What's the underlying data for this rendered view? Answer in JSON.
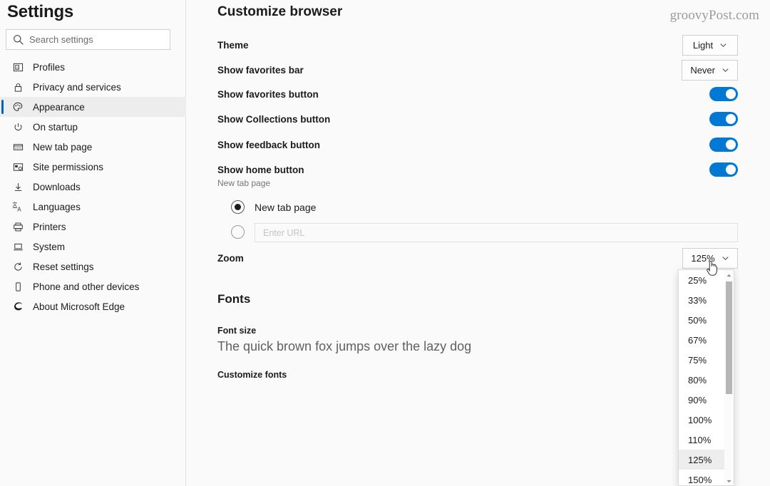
{
  "sidebar": {
    "title": "Settings",
    "search": {
      "placeholder": "Search settings",
      "icon": "search-icon"
    },
    "items": [
      {
        "label": "Profiles",
        "icon": "contact-card-icon",
        "active": false
      },
      {
        "label": "Privacy and services",
        "icon": "lock-icon",
        "active": false
      },
      {
        "label": "Appearance",
        "icon": "palette-icon",
        "active": true
      },
      {
        "label": "On startup",
        "icon": "power-icon",
        "active": false
      },
      {
        "label": "New tab page",
        "icon": "new-tab-icon",
        "active": false
      },
      {
        "label": "Site permissions",
        "icon": "permissions-icon",
        "active": false
      },
      {
        "label": "Downloads",
        "icon": "download-icon",
        "active": false
      },
      {
        "label": "Languages",
        "icon": "languages-icon",
        "active": false
      },
      {
        "label": "Printers",
        "icon": "printer-icon",
        "active": false
      },
      {
        "label": "System",
        "icon": "laptop-icon",
        "active": false
      },
      {
        "label": "Reset settings",
        "icon": "refresh-icon",
        "active": false
      },
      {
        "label": "Phone and other devices",
        "icon": "phone-icon",
        "active": false
      },
      {
        "label": "About Microsoft Edge",
        "icon": "edge-logo-icon",
        "active": false
      }
    ]
  },
  "main": {
    "page_title": "Customize browser",
    "watermark": "groovyPost.com",
    "rows": [
      {
        "label": "Theme",
        "control": "select",
        "value": "Light"
      },
      {
        "label": "Show favorites bar",
        "control": "select",
        "value": "Never"
      },
      {
        "label": "Show favorites button",
        "control": "toggle",
        "value": "on"
      },
      {
        "label": "Show Collections button",
        "control": "toggle",
        "value": "on"
      },
      {
        "label": "Show feedback button",
        "control": "toggle",
        "value": "on"
      },
      {
        "label": "Show home button",
        "control": "toggle",
        "value": "on"
      }
    ],
    "home_button_subtext": "New tab page",
    "home_option_newtab": "New tab page",
    "home_url_placeholder": "Enter URL",
    "zoom": {
      "label": "Zoom",
      "value": "125%"
    },
    "fonts": {
      "heading": "Fonts",
      "font_size_label": "Font size",
      "sample_text": "The quick brown fox jumps over the lazy dog",
      "customize_fonts_label": "Customize fonts"
    }
  },
  "zoom_dropdown": {
    "open": true,
    "selected": "125%",
    "options": [
      "25%",
      "33%",
      "50%",
      "67%",
      "75%",
      "80%",
      "90%",
      "100%",
      "110%",
      "125%",
      "150%"
    ]
  },
  "colors": {
    "accent": "#0078d4",
    "nav_accent_bar": "#0067b8",
    "page_bg": "#fafafa",
    "selected_row_bg": "#ededed"
  }
}
